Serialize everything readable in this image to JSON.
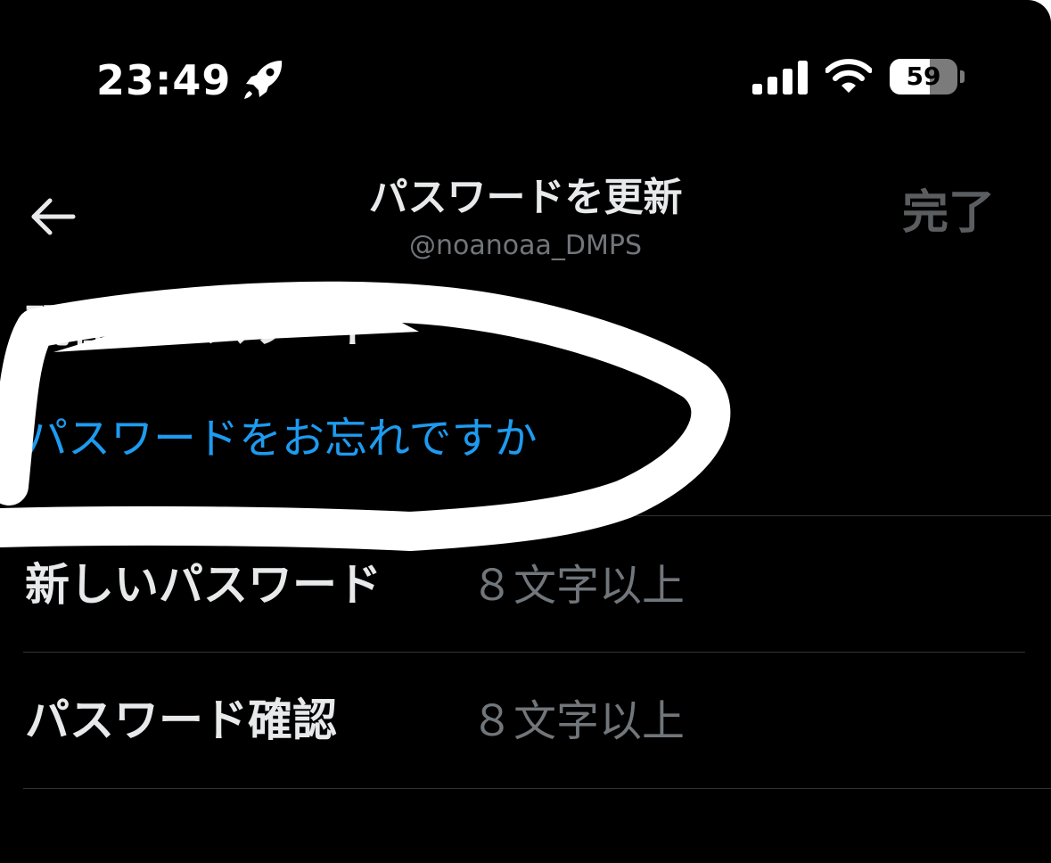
{
  "status_bar": {
    "time": "23:49",
    "battery_level": "59",
    "battery_fraction": 0.59,
    "icons": [
      "rocket-icon",
      "cellular-signal-icon",
      "wifi-icon",
      "battery-icon"
    ]
  },
  "header": {
    "back_icon": "arrow-left-icon",
    "title": "パスワードを更新",
    "handle": "@noanoaa_DMPS",
    "done_label": "完了"
  },
  "form": {
    "current_password": {
      "label": "現在のパスワード"
    },
    "forgot_password_link": "パスワードをお忘れですか",
    "new_password": {
      "label": "新しいパスワード",
      "placeholder": "８文字以上"
    },
    "confirm_password": {
      "label": "パスワード確認",
      "placeholder": "８文字以上"
    }
  },
  "colors": {
    "background": "#000000",
    "text_primary": "#e7e9ea",
    "text_secondary": "#71767b",
    "link": "#1d9bf0",
    "done_disabled": "#5b5e61",
    "divider": "#2f3336",
    "annotation": "#ffffff"
  }
}
